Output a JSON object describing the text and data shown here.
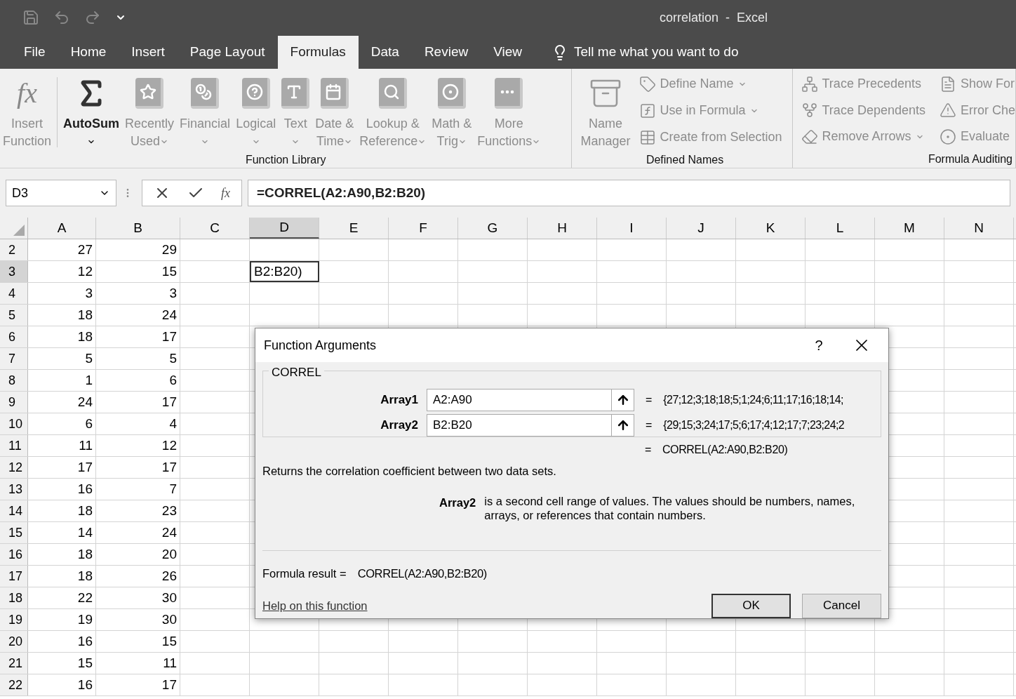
{
  "window": {
    "title": "correlation  -  Excel"
  },
  "tabs": [
    {
      "label": "File",
      "selected": false
    },
    {
      "label": "Home",
      "selected": false
    },
    {
      "label": "Insert",
      "selected": false
    },
    {
      "label": "Page Layout",
      "selected": false
    },
    {
      "label": "Formulas",
      "selected": true
    },
    {
      "label": "Data",
      "selected": false
    },
    {
      "label": "Review",
      "selected": false
    },
    {
      "label": "View",
      "selected": false
    }
  ],
  "tell_me": {
    "placeholder": "Tell me what you want to do"
  },
  "ribbon": {
    "groups": [
      {
        "label": "Function Library",
        "large": [
          {
            "glyph": "fx",
            "lines": [
              "Insert",
              "Function"
            ],
            "dropdown": false,
            "disabled": true
          },
          {
            "lines": [
              "AutoSum"
            ],
            "dropdown": true,
            "disabled": false
          },
          {
            "lines": [
              "Recently",
              "Used"
            ],
            "dropdown": true,
            "disabled": true
          },
          {
            "lines": [
              "Financial"
            ],
            "dropdown": true,
            "disabled": true
          },
          {
            "lines": [
              "Logical"
            ],
            "dropdown": true,
            "disabled": true
          },
          {
            "lines": [
              "Text"
            ],
            "dropdown": true,
            "disabled": true
          },
          {
            "lines": [
              "Date &",
              "Time"
            ],
            "dropdown": true,
            "disabled": true
          },
          {
            "lines": [
              "Lookup &",
              "Reference"
            ],
            "dropdown": true,
            "disabled": true
          },
          {
            "lines": [
              "Math &",
              "Trig"
            ],
            "dropdown": true,
            "disabled": true
          },
          {
            "lines": [
              "More",
              "Functions"
            ],
            "dropdown": true,
            "disabled": true
          }
        ]
      },
      {
        "label": "Defined Names",
        "large": [
          {
            "lines": [
              "Name",
              "Manager"
            ],
            "dropdown": false,
            "disabled": true
          }
        ],
        "small": [
          {
            "label": "Define Name",
            "dropdown": true,
            "disabled": true
          },
          {
            "label": "Use in Formula",
            "dropdown": true,
            "disabled": true
          },
          {
            "label": "Create from Selection",
            "dropdown": false,
            "disabled": true
          }
        ]
      },
      {
        "label": "Formula Auditing",
        "small": [
          {
            "label": "Trace Precedents",
            "dropdown": false,
            "disabled": true
          },
          {
            "label": "Trace Dependents",
            "dropdown": false,
            "disabled": true
          },
          {
            "label": "Remove Arrows",
            "dropdown": true,
            "disabled": true
          },
          {
            "label": "Show For",
            "dropdown": false,
            "disabled": true
          },
          {
            "label": "Error Che",
            "dropdown": false,
            "disabled": true
          },
          {
            "label": "Evaluate",
            "dropdown": false,
            "disabled": true
          }
        ]
      }
    ]
  },
  "formula_bar": {
    "name_box": "D3",
    "fx": "fx",
    "formula": "=CORREL(A2:A90,B2:B20)"
  },
  "sheet": {
    "columns": [
      {
        "label": "A",
        "selected": false
      },
      {
        "label": "B",
        "selected": false
      },
      {
        "label": "C",
        "selected": false
      },
      {
        "label": "D",
        "selected": true
      },
      {
        "label": "E",
        "selected": false
      },
      {
        "label": "F",
        "selected": false
      },
      {
        "label": "G",
        "selected": false
      },
      {
        "label": "H",
        "selected": false
      },
      {
        "label": "I",
        "selected": false
      },
      {
        "label": "J",
        "selected": false
      },
      {
        "label": "K",
        "selected": false
      },
      {
        "label": "L",
        "selected": false
      },
      {
        "label": "M",
        "selected": false
      },
      {
        "label": "N",
        "selected": false
      }
    ],
    "rows": [
      {
        "number": "2",
        "selected": false,
        "a": "27",
        "b": "29"
      },
      {
        "number": "3",
        "selected": true,
        "a": "12",
        "b": "15",
        "d": "B2:B20)"
      },
      {
        "number": "4",
        "selected": false,
        "a": "3",
        "b": "3"
      },
      {
        "number": "5",
        "selected": false,
        "a": "18",
        "b": "24"
      },
      {
        "number": "6",
        "selected": false,
        "a": "18",
        "b": "17"
      },
      {
        "number": "7",
        "selected": false,
        "a": "5",
        "b": "5"
      },
      {
        "number": "8",
        "selected": false,
        "a": "1",
        "b": "6"
      },
      {
        "number": "9",
        "selected": false,
        "a": "24",
        "b": "17"
      },
      {
        "number": "10",
        "selected": false,
        "a": "6",
        "b": "4"
      },
      {
        "number": "11",
        "selected": false,
        "a": "11",
        "b": "12"
      },
      {
        "number": "12",
        "selected": false,
        "a": "17",
        "b": "17"
      },
      {
        "number": "13",
        "selected": false,
        "a": "16",
        "b": "7"
      },
      {
        "number": "14",
        "selected": false,
        "a": "18",
        "b": "23"
      },
      {
        "number": "15",
        "selected": false,
        "a": "14",
        "b": "24"
      },
      {
        "number": "16",
        "selected": false,
        "a": "18",
        "b": "20"
      },
      {
        "number": "17",
        "selected": false,
        "a": "18",
        "b": "26"
      },
      {
        "number": "18",
        "selected": false,
        "a": "22",
        "b": "30"
      },
      {
        "number": "19",
        "selected": false,
        "a": "19",
        "b": "30"
      },
      {
        "number": "20",
        "selected": false,
        "a": "16",
        "b": "15"
      },
      {
        "number": "21",
        "selected": false,
        "a": "15",
        "b": "11"
      },
      {
        "number": "22",
        "selected": false,
        "a": "16",
        "b": "17"
      }
    ]
  },
  "dialog": {
    "title": "Function Arguments",
    "help": "?",
    "function": "CORREL",
    "arguments": [
      {
        "label": "Array1",
        "value": "A2:A90",
        "equals": "=",
        "result": "{27;12;3;18;18;5;1;24;6;11;17;16;18;14;"
      },
      {
        "label": "Array2",
        "value": "B2:B20",
        "equals": "=",
        "result": "{29;15;3;24;17;5;6;17;4;12;17;7;23;24;2"
      }
    ],
    "result_equals": "=",
    "result": "CORREL(A2:A90,B2:B20)",
    "description": "Returns the correlation coefficient between two data sets.",
    "arg_name": "Array2",
    "arg_description": "is a second cell range of values. The values should be numbers, names, arrays, or references that contain numbers.",
    "formula_result_label": "Formula result =",
    "formula_result": "CORREL(A2:A90,B2:B20)",
    "help_link": "Help on this function",
    "buttons": [
      {
        "label": "OK",
        "default": true
      },
      {
        "label": "Cancel",
        "default": false
      }
    ]
  }
}
